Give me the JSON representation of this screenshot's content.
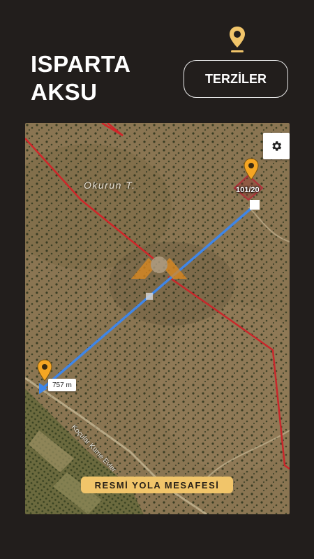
{
  "header": {
    "title_line1": "ISPARTA",
    "title_line2": "AKSU",
    "category_button": "TERZİLER"
  },
  "map": {
    "place_label": "Okurun T.",
    "road_label": "Koçular Küme Evler",
    "parcel_label": "101/20",
    "distance_label": "757 m",
    "banner": "RESMİ YOLA MESAFESİ"
  },
  "icons": {
    "top_pin": "map-pin-icon",
    "settings": "gear-icon",
    "parcel_pin": "map-pin-icon",
    "road_pin": "map-pin-icon"
  },
  "colors": {
    "background": "#221e1c",
    "accent": "#f1c56a",
    "route": "#3f86e8",
    "boundary": "#d0262a",
    "pin": "#f5a623"
  }
}
